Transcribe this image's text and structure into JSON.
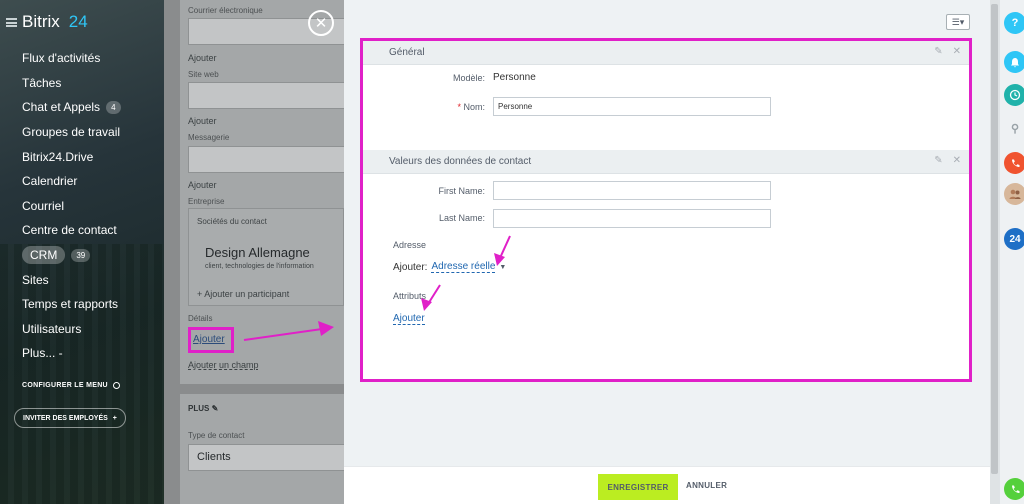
{
  "sidebar": {
    "brand": "Bitrix",
    "brand_num": "24",
    "items": [
      {
        "label": "Flux d'activités"
      },
      {
        "label": "Tâches"
      },
      {
        "label": "Chat et Appels",
        "badge": "4"
      },
      {
        "label": "Groupes de travail"
      },
      {
        "label": "Bitrix24.Drive"
      },
      {
        "label": "Calendrier"
      },
      {
        "label": "Courriel"
      },
      {
        "label": "Centre de contact"
      },
      {
        "label": "CRM",
        "badge": "39"
      },
      {
        "label": "Sites"
      },
      {
        "label": "Temps et rapports"
      },
      {
        "label": "Utilisateurs"
      },
      {
        "label": "Plus... -"
      }
    ],
    "configure": "CONFIGURER LE MENU",
    "invite": "INVITER DES EMPLOYÉS"
  },
  "midform": {
    "email_label": "Courrier électronique",
    "add1": "Ajouter",
    "website_label": "Site web",
    "add2": "Ajouter",
    "messenger_label": "Messagerie",
    "add3": "Ajouter",
    "company_label": "Entreprise",
    "companies_header": "Sociétés du contact",
    "company_name": "Design Allemagne",
    "company_sub": "client, technologies de l'information",
    "add_participant": "+ Ajouter un participant",
    "details_label": "Détails",
    "details_add": "Ajouter",
    "add_field": "Ajouter un champ",
    "plus_label": "PLUS",
    "contact_type_label": "Type de contact",
    "contact_type_value": "Clients"
  },
  "panel": {
    "section_general": "Général",
    "model_label": "Modèle:",
    "model_value": "Personne",
    "name_label": "Nom:",
    "name_value": "Personne",
    "section_contact": "Valeurs des données de contact",
    "first_name_label": "First Name:",
    "last_name_label": "Last Name:",
    "address_label": "Adresse",
    "address_add": "Ajouter:",
    "address_link": "Adresse réelle",
    "attribute_label": "Attributs",
    "attribute_add": "Ajouter"
  },
  "footer": {
    "save": "ENREGISTRER",
    "cancel": "ANNULER"
  },
  "rail": {
    "help": "?",
    "b24": "24"
  },
  "colors": {
    "highlight": "#e020c8",
    "save_button": "#bbed21",
    "link": "#2067b0",
    "brand_accent": "#2fc6f6"
  }
}
